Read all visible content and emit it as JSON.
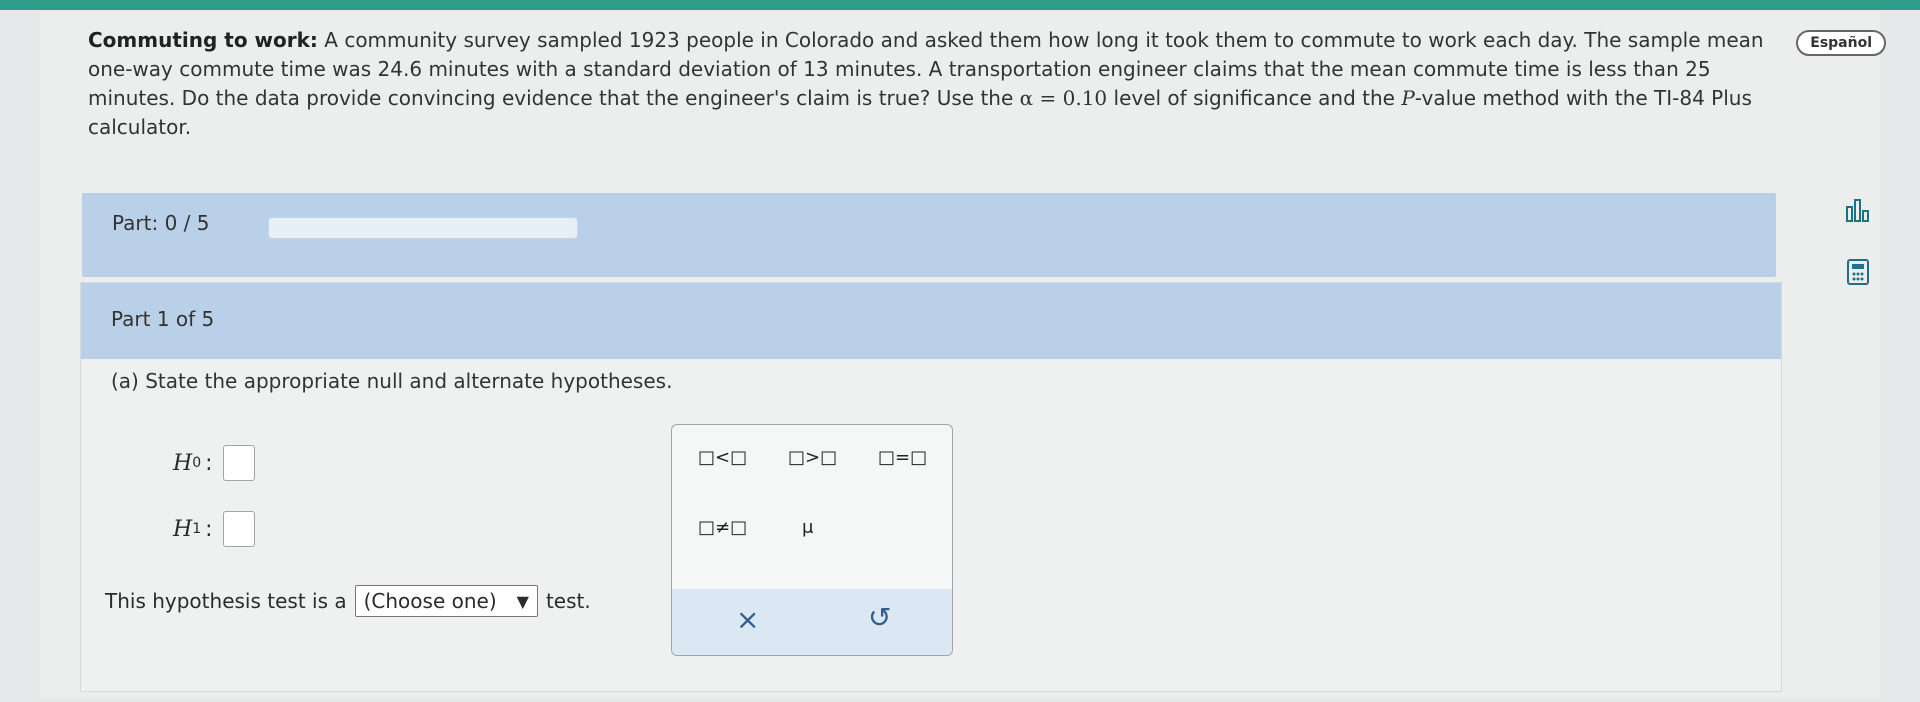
{
  "question": {
    "title": "Commuting to work:",
    "text_1": " A community survey sampled 1923 people in Colorado and asked them how long it took them to commute to work each day. The sample mean one-way commute time was 24.6 minutes with a standard deviation of 13 minutes. A transportation engineer claims that the mean commute time is less than 25 minutes. Do the data provide convincing evidence that the engineer's claim is true? Use the ",
    "alpha": "α = 0.10",
    "text_2": " level of significance and the ",
    "p_letter": "P",
    "text_3": "-value method with the TI-84 Plus calculator."
  },
  "language_button": "Español",
  "part_progress": {
    "label": "Part: 0 / 5",
    "fraction": 0
  },
  "part_header": "Part 1 of 5",
  "prompt": "(a) State the appropriate null and alternate hypotheses.",
  "hypotheses": {
    "h0_letter": "H",
    "h0_sub": "0",
    "h1_letter": "H",
    "h1_sub": "1",
    "colon": ":"
  },
  "test_line": {
    "before": "This hypothesis test is a",
    "select_value": "(Choose one)",
    "after": "test."
  },
  "palette": {
    "lt": "□<□",
    "gt": "□>□",
    "eq": "□=□",
    "neq": "□≠□",
    "mu": "μ",
    "clear": "×",
    "undo": "↺"
  },
  "icons": [
    "chart-icon",
    "calculator-icon",
    "dropdown-arrow-icon"
  ]
}
